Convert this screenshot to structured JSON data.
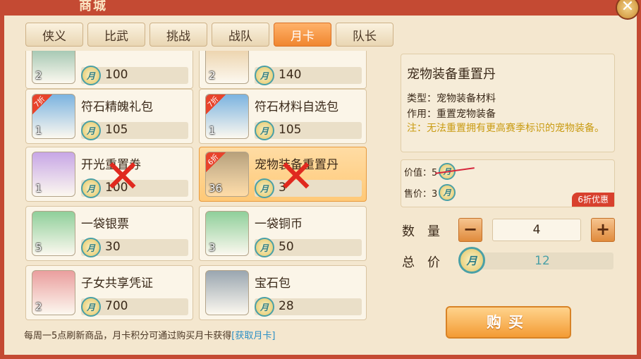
{
  "window": {
    "title": "商城",
    "close_icon": "close-icon"
  },
  "tabs": [
    {
      "label": "侠义",
      "active": false
    },
    {
      "label": "比武",
      "active": false
    },
    {
      "label": "挑战",
      "active": false
    },
    {
      "label": "战队",
      "active": false
    },
    {
      "label": "月卡",
      "active": true
    },
    {
      "label": "队长",
      "active": false
    }
  ],
  "currency_glyph": "月",
  "items": [
    {
      "name": "",
      "qty": "2",
      "price": "100",
      "discount": "",
      "thumb_color": "#8ab9a0",
      "crossed": false
    },
    {
      "name": "",
      "qty": "2",
      "price": "140",
      "discount": "",
      "thumb_color": "#e8c99a",
      "crossed": false
    },
    {
      "name": "符石精魄礼包",
      "qty": "1",
      "price": "105",
      "discount": "7折",
      "thumb_color": "#7bb3e0",
      "crossed": false
    },
    {
      "name": "符石材料自选包",
      "qty": "1",
      "price": "105",
      "discount": "7折",
      "thumb_color": "#7bb3e0",
      "crossed": false
    },
    {
      "name": "开光重置券",
      "qty": "1",
      "price": "100",
      "discount": "",
      "thumb_color": "#c7a6e6",
      "crossed": true
    },
    {
      "name": "宠物装备重置丹",
      "qty": "36",
      "price": "3",
      "discount": "6折",
      "thumb_color": "#b7a07a",
      "crossed": true,
      "selected": true
    },
    {
      "name": "一袋银票",
      "qty": "5",
      "price": "30",
      "discount": "",
      "thumb_color": "#8fcf9a",
      "crossed": false
    },
    {
      "name": "一袋铜币",
      "qty": "3",
      "price": "50",
      "discount": "",
      "thumb_color": "#8fcf9a",
      "crossed": false
    },
    {
      "name": "子女共享凭证",
      "qty": "2",
      "price": "700",
      "discount": "",
      "thumb_color": "#ea9e9e",
      "crossed": false
    },
    {
      "name": "宝石包",
      "qty": "",
      "price": "28",
      "discount": "",
      "thumb_color": "#9aa6b0",
      "crossed": false
    }
  ],
  "footer": {
    "text": "每周一5点刷新商品，月卡积分可通过购买月卡获得",
    "link": "[获取月卡]"
  },
  "detail": {
    "title": "宠物装备重置丹",
    "type_line": "类型：宠物装备材料",
    "use_line": "作用：重置宠物装备",
    "note_line": "注：无法重置拥有更高赛季标识的宠物装备。"
  },
  "pricing": {
    "original_label": "价值：5",
    "sale_label": "售价：3",
    "promo": "6折优惠"
  },
  "quantity": {
    "label": "数量",
    "value": "4",
    "minus_icon": "minus-icon",
    "plus_icon": "plus-icon"
  },
  "total": {
    "label": "总价",
    "value": "12"
  },
  "buy_button": "购买",
  "colors": {
    "accent": "#f39b34",
    "frame": "#c44a33",
    "crossout": "#e0291f"
  }
}
